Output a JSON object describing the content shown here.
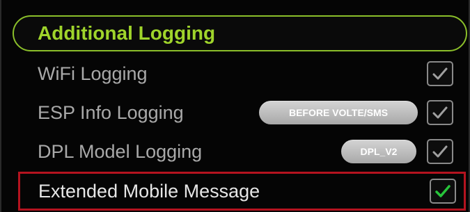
{
  "section": {
    "title": "Additional Logging",
    "accent_color": "#9fd42b"
  },
  "rows": [
    {
      "label": "WiFi Logging",
      "checked": true
    },
    {
      "label": "ESP Info Logging",
      "pill": "BEFORE VOLTE/SMS",
      "checked": true
    },
    {
      "label": "DPL Model Logging",
      "pill": "DPL_V2",
      "checked": true
    },
    {
      "label": "Extended Mobile Message",
      "checked": true,
      "highlighted": true,
      "check_color": "#27c43a"
    }
  ],
  "highlight_color": "#b4131f"
}
